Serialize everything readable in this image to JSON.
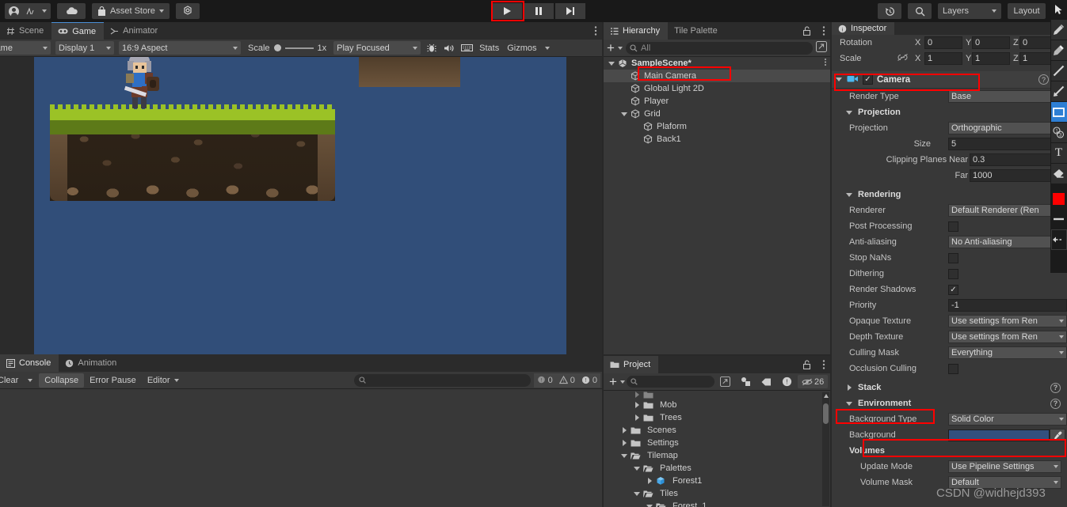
{
  "toolbar": {
    "account_icon": "account-icon",
    "cloud_icon": "cloud-icon",
    "asset_store_label": "Asset Store",
    "settings_icon": "gear-icon",
    "play_icon": "play-icon",
    "pause_icon": "pause-icon",
    "step_icon": "step-icon",
    "history_icon": "history-icon",
    "search_icon": "search-icon",
    "layers_label": "Layers",
    "layout_label": "Layout"
  },
  "game_view": {
    "tabs": [
      {
        "label": "Scene",
        "icon": "grid-icon",
        "active": false
      },
      {
        "label": "Game",
        "icon": "gamepad-icon",
        "active": true
      },
      {
        "label": "Animator",
        "icon": "animator-icon",
        "active": false
      }
    ],
    "display_target": "Game",
    "display": "Display 1",
    "aspect": "16:9 Aspect",
    "scale_label": "Scale",
    "scale_value": "1x",
    "play_mode": "Play Focused",
    "mute_icon": "audio-icon",
    "bug_icon": "bug-icon",
    "keyboard_icon": "keyboard-icon",
    "stats_label": "Stats",
    "gizmos_label": "Gizmos",
    "menu_icon": "kebab-menu-icon",
    "background_color": "#314e79"
  },
  "console": {
    "tabs": [
      {
        "label": "Console",
        "icon": "console-icon",
        "active": true
      },
      {
        "label": "Animation",
        "icon": "clock-icon",
        "active": false
      }
    ],
    "clear_label": "Clear",
    "collapse_label": "Collapse",
    "error_pause_label": "Error Pause",
    "editor_label": "Editor",
    "search_placeholder": "",
    "counts": {
      "log": "0",
      "warning": "0",
      "error": "0"
    }
  },
  "hierarchy": {
    "tabs": [
      {
        "label": "Hierarchy",
        "icon": "hierarchy-icon",
        "active": true
      },
      {
        "label": "Tile Palette",
        "icon": "",
        "active": false
      }
    ],
    "lock_icon": "lock-open-icon",
    "menu_icon": "kebab-menu-icon",
    "add_label": "+",
    "search_placeholder": "All",
    "items": [
      {
        "label": "SampleScene*",
        "depth": 0,
        "icon": "unity-scene-icon",
        "expander": "down",
        "bold": true,
        "selected": false,
        "highlight": false
      },
      {
        "label": "Main Camera",
        "depth": 1,
        "icon": "gameobject-icon",
        "expander": "none",
        "bold": false,
        "selected": true,
        "highlight": true
      },
      {
        "label": "Global Light 2D",
        "depth": 1,
        "icon": "gameobject-icon",
        "expander": "none",
        "bold": false,
        "selected": false,
        "highlight": false
      },
      {
        "label": "Player",
        "depth": 1,
        "icon": "gameobject-icon",
        "expander": "none",
        "bold": false,
        "selected": false,
        "highlight": false
      },
      {
        "label": "Grid",
        "depth": 1,
        "icon": "gameobject-icon",
        "expander": "down",
        "bold": false,
        "selected": false,
        "highlight": false
      },
      {
        "label": "Plaform",
        "depth": 2,
        "icon": "gameobject-icon",
        "expander": "none",
        "bold": false,
        "selected": false,
        "highlight": false
      },
      {
        "label": "Back1",
        "depth": 2,
        "icon": "gameobject-icon",
        "expander": "none",
        "bold": false,
        "selected": false,
        "highlight": false
      }
    ]
  },
  "project": {
    "tab_label": "Project",
    "tab_icon": "folder-icon",
    "lock_icon": "lock-open-icon",
    "menu_icon": "kebab-menu-icon",
    "add_label": "+",
    "search_placeholder": "",
    "badge_count": "26",
    "items": [
      {
        "label": "",
        "depth": 2,
        "icon": "folder-icon",
        "expander": "right",
        "partial": true
      },
      {
        "label": "Mob",
        "depth": 2,
        "icon": "folder-icon",
        "expander": "right"
      },
      {
        "label": "Trees",
        "depth": 2,
        "icon": "folder-icon",
        "expander": "right"
      },
      {
        "label": "Scenes",
        "depth": 1,
        "icon": "folder-icon",
        "expander": "right"
      },
      {
        "label": "Settings",
        "depth": 1,
        "icon": "folder-icon",
        "expander": "right"
      },
      {
        "label": "Tilemap",
        "depth": 1,
        "icon": "folder-open-icon",
        "expander": "down"
      },
      {
        "label": "Palettes",
        "depth": 2,
        "icon": "folder-open-icon",
        "expander": "down"
      },
      {
        "label": "Forest1",
        "depth": 3,
        "icon": "prefab-icon",
        "expander": "right"
      },
      {
        "label": "Tiles",
        "depth": 2,
        "icon": "folder-open-icon",
        "expander": "down"
      },
      {
        "label": "Forest_1",
        "depth": 3,
        "icon": "folder-open-icon",
        "expander": "down"
      }
    ]
  },
  "inspector": {
    "tab_label": "Inspector",
    "tab_icon": "info-icon",
    "transform": {
      "rotation_label": "Rotation",
      "rotation": {
        "x_label": "X",
        "x": "0",
        "y_label": "Y",
        "y": "0",
        "z_label": "Z",
        "z": "0"
      },
      "scale_label": "Scale",
      "scale_link_icon": "link-off-icon",
      "scale": {
        "x_label": "X",
        "x": "1",
        "y_label": "Y",
        "y": "1",
        "z_label": "Z",
        "z": "1"
      }
    },
    "camera_component": {
      "title": "Camera",
      "icon": "camera-icon",
      "enabled": true,
      "help_icon": "help-icon",
      "preset_icon": "preset-icon",
      "render_type_label": "Render Type",
      "render_type_value": "Base"
    },
    "projection": {
      "title": "Projection",
      "projection_label": "Projection",
      "projection_value": "Orthographic",
      "size_label": "Size",
      "size_value": "5",
      "clipping_label": "Clipping Planes Near",
      "near_value": "0.3",
      "far_label": "Far",
      "far_value": "1000"
    },
    "rendering": {
      "title": "Rendering",
      "renderer_label": "Renderer",
      "renderer_value": "Default Renderer (Ren",
      "post_processing_label": "Post Processing",
      "post_processing_checked": false,
      "anti_aliasing_label": "Anti-aliasing",
      "anti_aliasing_value": "No Anti-aliasing",
      "stop_nans_label": "Stop NaNs",
      "stop_nans_checked": false,
      "dithering_label": "Dithering",
      "dithering_checked": false,
      "render_shadows_label": "Render Shadows",
      "render_shadows_checked": true,
      "priority_label": "Priority",
      "priority_value": "-1",
      "opaque_texture_label": "Opaque Texture",
      "opaque_texture_value": "Use settings from Ren",
      "depth_texture_label": "Depth Texture",
      "depth_texture_value": "Use settings from Ren",
      "culling_mask_label": "Culling Mask",
      "culling_mask_value": "Everything",
      "occlusion_culling_label": "Occlusion Culling",
      "occlusion_culling_checked": false
    },
    "stack": {
      "title": "Stack"
    },
    "environment": {
      "title": "Environment",
      "background_type_label": "Background Type",
      "background_type_value": "Solid Color",
      "background_label": "Background",
      "background_color": "#33507e",
      "eyedropper_icon": "eyedropper-icon"
    },
    "volumes": {
      "title": "Volumes",
      "update_mode_label": "Update Mode",
      "update_mode_value": "Use Pipeline Settings",
      "volume_mask_label": "Volume Mask",
      "volume_mask_value": "Default"
    }
  },
  "right_toolbar": {
    "buttons": [
      {
        "icon": "cursor-arrow-icon",
        "selected": false
      },
      {
        "icon": "pencil-icon",
        "selected": false
      },
      {
        "icon": "marker-icon",
        "selected": false
      },
      {
        "icon": "line-icon",
        "selected": false
      },
      {
        "icon": "arrow-icon",
        "selected": false
      },
      {
        "icon": "rectangle-icon",
        "selected": true
      },
      {
        "icon": "number-stamp-icon",
        "selected": false
      },
      {
        "icon": "text-icon",
        "selected": false
      },
      {
        "icon": "eraser-icon",
        "selected": false
      },
      {
        "icon": "color-red-icon",
        "selected": false
      },
      {
        "icon": "stroke-width-icon",
        "selected": false
      },
      {
        "icon": "undo-icon",
        "selected": false
      }
    ],
    "active_color": "#ff0000"
  },
  "watermark": "CSDN @widhejd393"
}
